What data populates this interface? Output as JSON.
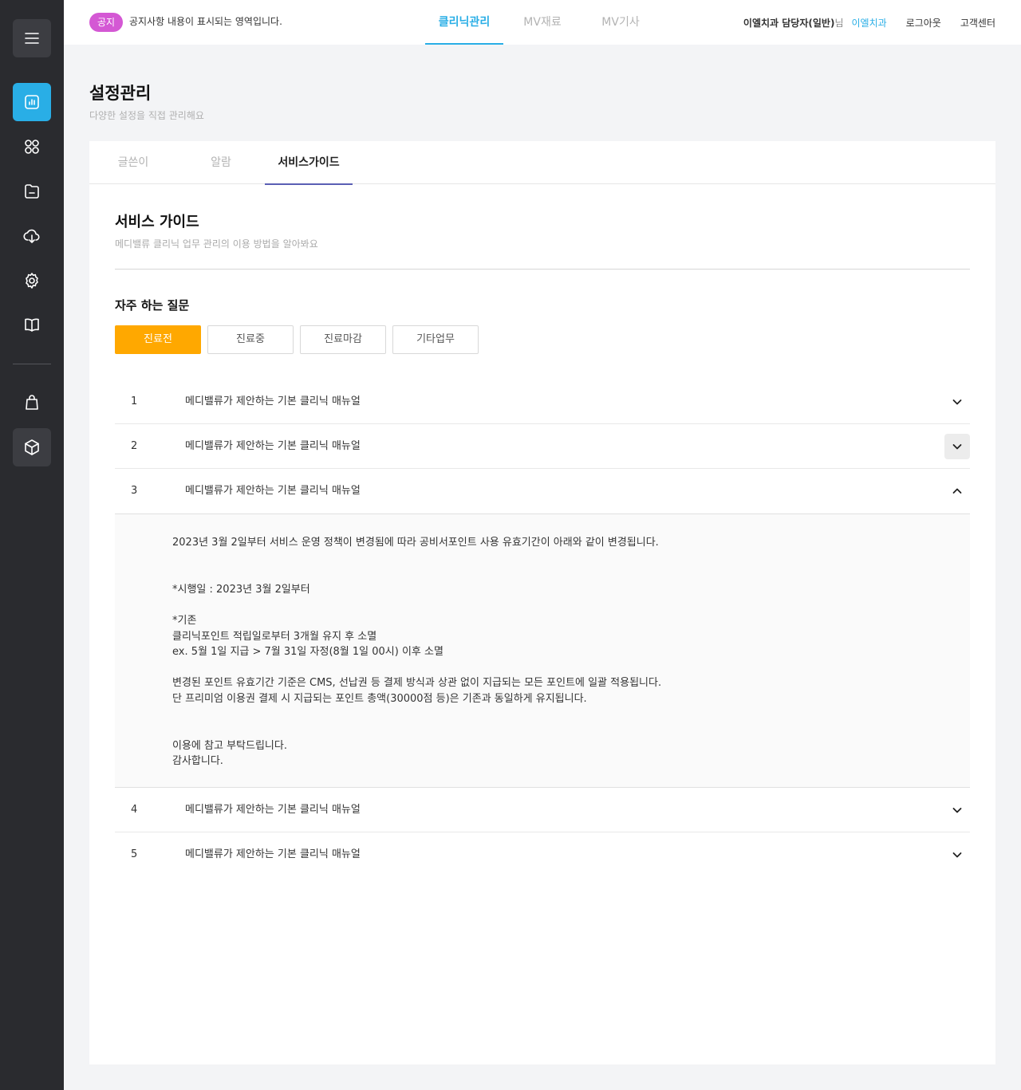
{
  "topbar": {
    "notice_badge": "공지",
    "notice_text": "공지사항 내용이 표시되는 영역입니다.",
    "tabs": [
      {
        "label": "클리닉관리",
        "active": true
      },
      {
        "label": "MV재료",
        "active": false
      },
      {
        "label": "MV기사",
        "active": false
      }
    ],
    "user_name": "이엘치과 담당자(일반)",
    "user_suffix": "님",
    "clinic_name": "이엘치과",
    "logout_label": "로그아웃",
    "support_label": "고객센터"
  },
  "sidebar": {
    "icons": [
      "menu-icon",
      "chart-icon",
      "grid-icon",
      "folder-icon",
      "cloud-download-icon",
      "gear-icon",
      "book-icon",
      "shopping-bag-icon",
      "box-icon"
    ],
    "accent": "#29aee6"
  },
  "page": {
    "title": "설정관리",
    "subtitle": "다양한 설정을 직접 관리해요"
  },
  "card_tabs": [
    {
      "label": "글쓴이",
      "active": false
    },
    {
      "label": "알람",
      "active": false
    },
    {
      "label": "서비스가이드",
      "active": true
    }
  ],
  "section": {
    "title": "서비스 가이드",
    "subtitle": "메디밸류 클리닉 업무 관리의 이용 방법을 알아봐요"
  },
  "faq": {
    "title": "자주 하는 질문",
    "filters": [
      {
        "label": "진료전",
        "active": true
      },
      {
        "label": "진료중",
        "active": false
      },
      {
        "label": "진료마감",
        "active": false
      },
      {
        "label": "기타업무",
        "active": false
      }
    ],
    "items": [
      {
        "num": "1",
        "question": "메디밸류가 제안하는 기본 클리닉 매뉴얼",
        "expanded": false
      },
      {
        "num": "2",
        "question": "메디밸류가 제안하는 기본 클리닉 매뉴얼",
        "expanded": false
      },
      {
        "num": "3",
        "question": "메디밸류가 제안하는 기본 클리닉 매뉴얼",
        "expanded": true
      },
      {
        "num": "4",
        "question": "메디밸류가 제안하는 기본 클리닉 매뉴얼",
        "expanded": false
      },
      {
        "num": "5",
        "question": "메디밸류가 제안하는 기본 클리닉 매뉴얼",
        "expanded": false
      }
    ],
    "answer_lines": [
      "2023년 3월 2일부터 서비스 운영 정책이 변경됨에 따라 공비서포인트 사용 유효기간이 아래와 같이 변경됩니다.",
      "",
      "",
      "*시행일 : 2023년 3월 2일부터",
      "",
      "*기존",
      "클리닉포인트 적립일로부터 3개월 유지 후 소멸",
      "ex. 5월 1일 지급 > 7월 31일 자정(8월 1일 00시) 이후 소멸",
      "",
      "변경된 포인트 유효기간 기준은 CMS, 선납권 등 결제 방식과 상관 없이 지급되는 모든 포인트에 일괄 적용됩니다.",
      "단 프리미엄 이용권 결제 시 지급되는 포인트 총액(30000점 등)은 기존과 동일하게 유지됩니다.",
      "",
      "",
      "이용에 참고 부탁드립니다.",
      "감사합니다."
    ]
  },
  "colors": {
    "accent": "#29aee6",
    "filter_active": "#ffa800",
    "notice_badge": "#d458d4",
    "tab_underline": "#5a5fb4"
  }
}
